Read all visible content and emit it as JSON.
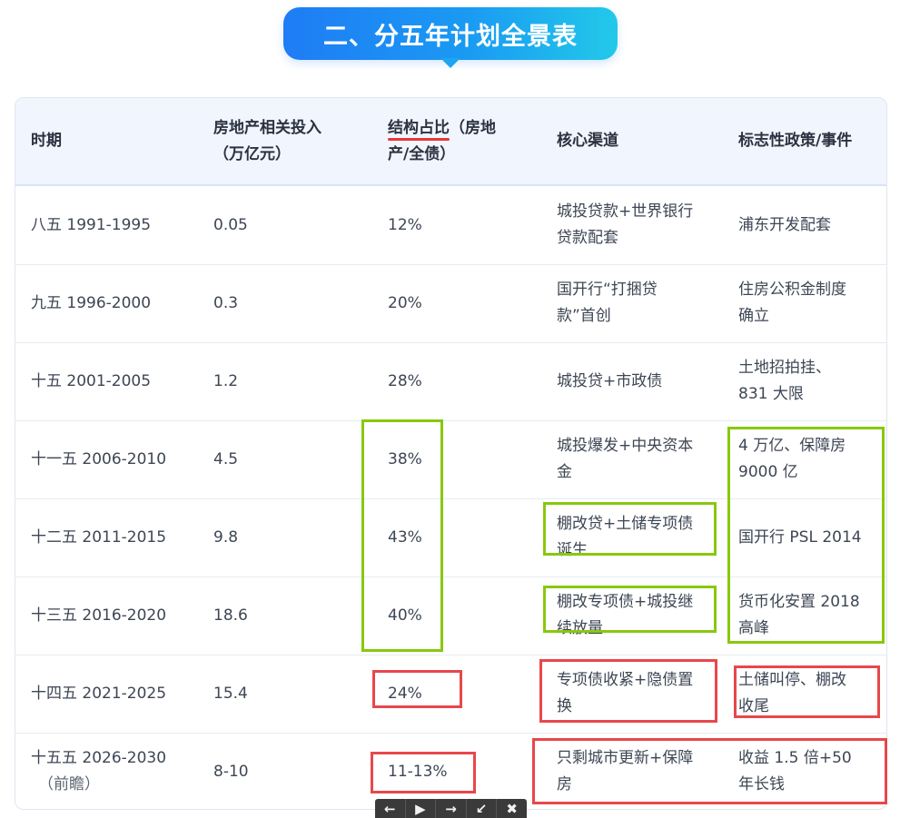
{
  "banner": {
    "title": "二、分五年计划全景表"
  },
  "table": {
    "headers": {
      "col1": "时期",
      "col2_line1": "房地产相关投入",
      "col2_line2": "（万亿元）",
      "col3_marked": "结构占比",
      "col3_rest1": "（房地",
      "col3_line2": "产/全债）",
      "col4": "核心渠道",
      "col5": "标志性政策/事件"
    },
    "rows": [
      {
        "period": "八五 1991-1995",
        "period_note": "",
        "investment": "0.05",
        "share": "12%",
        "channel_l1": "城投贷款+世界银行",
        "channel_l2": "贷款配套",
        "event_l1": "浦东开发配套",
        "event_l2": ""
      },
      {
        "period": "九五 1996-2000",
        "period_note": "",
        "investment": "0.3",
        "share": "20%",
        "channel_l1": "国开行“打捆贷",
        "channel_l2": "款”首创",
        "event_l1": "住房公积金制度",
        "event_l2": "确立"
      },
      {
        "period": "十五 2001-2005",
        "period_note": "",
        "investment": "1.2",
        "share": "28%",
        "channel_l1": "城投贷+市政债",
        "channel_l2": "",
        "event_l1": "土地招拍挂、",
        "event_l2": "831 大限"
      },
      {
        "period": "十一五 2006-2010",
        "period_note": "",
        "investment": "4.5",
        "share": "38%",
        "channel_l1": "城投爆发+中央资本",
        "channel_l2": "金",
        "event_l1": "4 万亿、保障房",
        "event_l2": "9000 亿"
      },
      {
        "period": "十二五 2011-2015",
        "period_note": "",
        "investment": "9.8",
        "share": "43%",
        "channel_l1": "棚改贷+土储专项债",
        "channel_l2": "诞生",
        "event_l1": "国开行 PSL 2014",
        "event_l2": ""
      },
      {
        "period": "十三五 2016-2020",
        "period_note": "",
        "investment": "18.6",
        "share": "40%",
        "channel_l1": "棚改专项债+城投继",
        "channel_l2": "续放量",
        "event_l1": "货币化安置 2018",
        "event_l2": "高峰"
      },
      {
        "period": "十四五 2021-2025",
        "period_note": "",
        "investment": "15.4",
        "share": "24%",
        "channel_l1": "专项债收紧+隐债置",
        "channel_l2": "换",
        "event_l1": "土储叫停、棚改",
        "event_l2": "收尾"
      },
      {
        "period": "十五五 2026-2030",
        "period_note": "（前瞻）",
        "investment": "8-10",
        "share": "11-13%",
        "channel_l1": "只剩城市更新+保障",
        "channel_l2": "房",
        "event_l1": "收益 1.5 倍+50",
        "event_l2": "年长钱"
      }
    ]
  },
  "colors": {
    "banner_start": "#1f7cf5",
    "banner_end": "#22c9e9",
    "highlight_green": "#88c80e",
    "highlight_red": "#e8474b"
  },
  "toolbar": {
    "icons": [
      "arrow-left-icon",
      "play-icon",
      "arrow-right-icon",
      "shrink-icon",
      "close-icon"
    ]
  }
}
